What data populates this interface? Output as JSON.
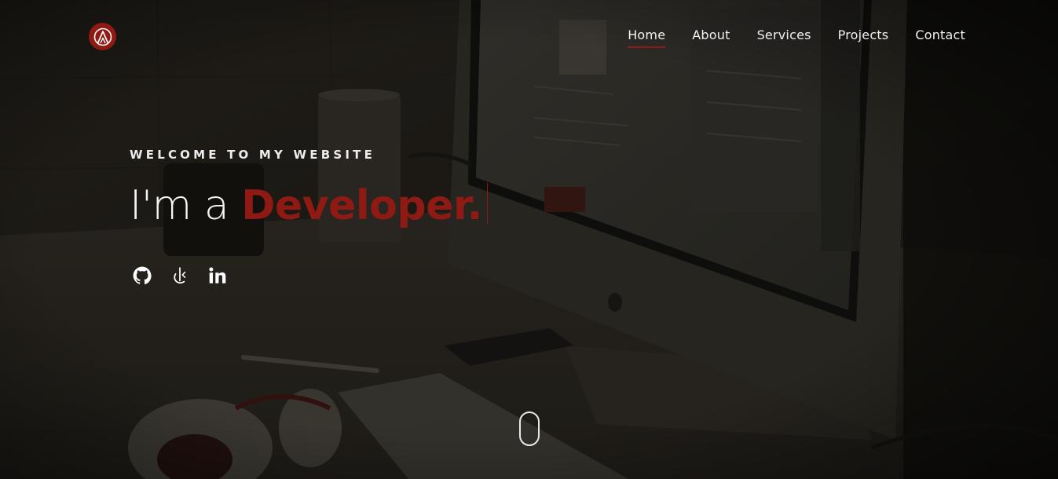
{
  "nav": {
    "logo_icon": "summit-letter-a-logo-icon",
    "items": [
      {
        "label": "Home",
        "active": true
      },
      {
        "label": "About",
        "active": false
      },
      {
        "label": "Services",
        "active": false
      },
      {
        "label": "Projects",
        "active": false
      },
      {
        "label": "Contact",
        "active": false
      }
    ]
  },
  "hero": {
    "tagline": "WELCOME TO MY WEBSITE",
    "lead": "I'm a ",
    "role": "Developer."
  },
  "social": [
    {
      "icon": "github-icon"
    },
    {
      "icon": "leetcode-icon"
    },
    {
      "icon": "linkedin-icon"
    }
  ],
  "scroll_indicator": {
    "icon": "mouse-scroll-icon"
  },
  "colors": {
    "accent": "#8f1a14",
    "text": "#f2f2f2",
    "overlay": "#141210"
  }
}
